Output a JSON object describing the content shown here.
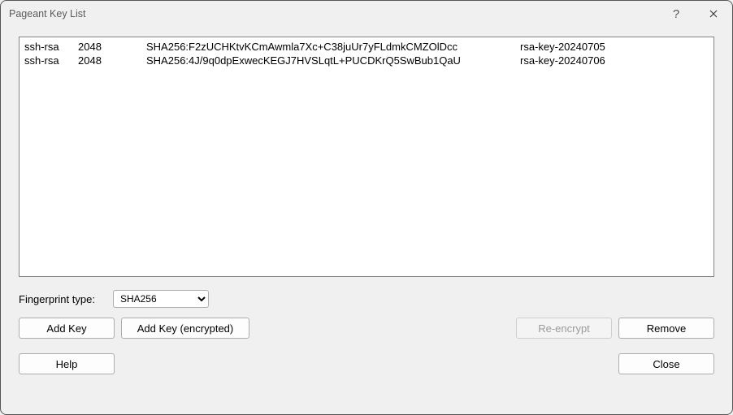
{
  "window": {
    "title": "Pageant Key List"
  },
  "keys": [
    {
      "type": "ssh-rsa",
      "bits": "2048",
      "fingerprint": "SHA256:F2zUCHKtvKCmAwmla7Xc+C38juUr7yFLdmkCMZOlDcc",
      "name": "rsa-key-20240705"
    },
    {
      "type": "ssh-rsa",
      "bits": "2048",
      "fingerprint": "SHA256:4J/9q0dpExwecKEGJ7HVSLqtL+PUCDKrQ5SwBub1QaU",
      "name": "rsa-key-20240706"
    }
  ],
  "fingerprint": {
    "label": "Fingerprint type:",
    "selected": "SHA256"
  },
  "buttons": {
    "add_key": "Add Key",
    "add_key_encrypted": "Add Key (encrypted)",
    "reencrypt": "Re-encrypt",
    "remove": "Remove",
    "help": "Help",
    "close": "Close"
  }
}
